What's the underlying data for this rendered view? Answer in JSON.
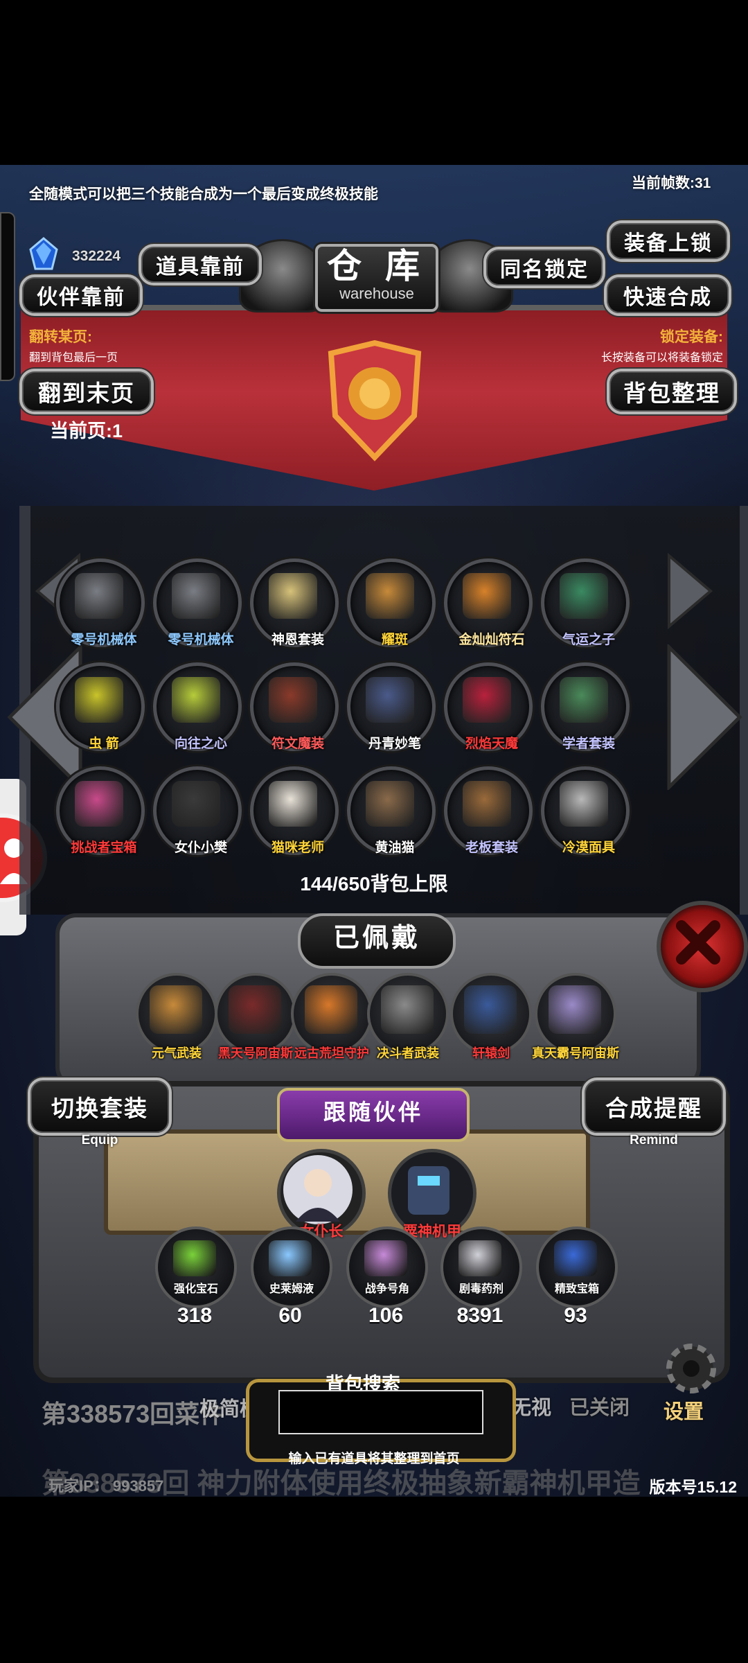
{
  "hud": {
    "hint": "全随模式可以把三个技能合成为一个最后变成终极技能",
    "fps": "当前帧数:31",
    "gem_value": "332224"
  },
  "header": {
    "title": "仓 库",
    "subtitle": "warehouse",
    "buttons": {
      "items_front": "道具靠前",
      "partner_front": "伙伴靠前",
      "same_name_lock": "同名锁定",
      "equip_lock": "装备上锁",
      "quick_merge": "快速合成",
      "to_last_page": "翻到末页",
      "bag_sort": "背包整理"
    },
    "flip_label": "翻转某页:",
    "flip_desc": "翻到背包最后一页",
    "lock_label": "锁定装备:",
    "lock_desc": "长按装备可以将装备锁定",
    "current_page": "当前页:1"
  },
  "inventory": {
    "items": [
      {
        "label": "零号机械体",
        "color": "#8ec9ff",
        "icon": "#7a7d84"
      },
      {
        "label": "零号机械体",
        "color": "#8ec9ff",
        "icon": "#7a7d84"
      },
      {
        "label": "神恩套装",
        "color": "#ffffff",
        "icon": "#d7c27a"
      },
      {
        "label": "耀斑",
        "color": "#ffd53a",
        "icon": "#c78a3a"
      },
      {
        "label": "金灿灿符石",
        "color": "#ffe7a0",
        "icon": "#d8822a"
      },
      {
        "label": "气运之子",
        "color": "#c3c3ff",
        "icon": "#3a8a62"
      },
      {
        "label": "虫 箭",
        "color": "#ffd53a",
        "icon": "#c9c42a"
      },
      {
        "label": "向往之心",
        "color": "#c3c3ff",
        "icon": "#b7cc3a"
      },
      {
        "label": "符文魔装",
        "color": "#ff5a5a",
        "icon": "#8a3a2a"
      },
      {
        "label": "丹青妙笔",
        "color": "#ffffff",
        "icon": "#4a5a8a"
      },
      {
        "label": "烈焰天魔",
        "color": "#ff3a3a",
        "icon": "#b8213c"
      },
      {
        "label": "学者套装",
        "color": "#c3c3ff",
        "icon": "#4a8a5a"
      },
      {
        "label": "挑战者宝箱",
        "color": "#ff3a3a",
        "icon": "#c84a8a"
      },
      {
        "label": "女仆小樊",
        "color": "#ffffff",
        "icon": "#3a3a3a"
      },
      {
        "label": "猫咪老师",
        "color": "#ffd53a",
        "icon": "#e8e2d8"
      },
      {
        "label": "黄油猫",
        "color": "#ffffff",
        "icon": "#8a6a4a"
      },
      {
        "label": "老板套装",
        "color": "#c3c3ff",
        "icon": "#9a6a3a"
      },
      {
        "label": "冷漠面具",
        "color": "#ffd53a",
        "icon": "#b8b8b8"
      }
    ],
    "capacity": "144/650背包上限"
  },
  "equipped": {
    "title": "已佩戴",
    "items": [
      {
        "label": "元气武装",
        "color": "#ffd53a",
        "icon": "#c78a3a"
      },
      {
        "label": "黑天号阿宙斯",
        "color": "#ff3a3a",
        "icon": "#7a2a2a"
      },
      {
        "label": "远古荒坦守护",
        "color": "#ff3a3a",
        "icon": "#d7782a"
      },
      {
        "label": "决斗者武装",
        "color": "#ffd53a",
        "icon": "#8a8a8a"
      },
      {
        "label": "轩辕剑",
        "color": "#ff3a3a",
        "icon": "#3a5a9a"
      },
      {
        "label": "真天霸号阿宙斯",
        "color": "#ffd53a",
        "icon": "#9a8ac8"
      }
    ]
  },
  "controls": {
    "switch_set": "切换套装",
    "switch_set_sub": "Equip",
    "merge_remind": "合成提醒",
    "merge_remind_sub": "Remind"
  },
  "follow": {
    "title": "跟随伙伴",
    "partners": [
      {
        "label": "女仆长",
        "color": "#ff3a3a"
      },
      {
        "label": "粟神机甲",
        "color": "#ff3a3a"
      }
    ]
  },
  "resources": [
    {
      "label": "强化宝石",
      "count": "318",
      "icon": "#7ad23a"
    },
    {
      "label": "史莱姆液",
      "count": "60",
      "icon": "#8ac8ff"
    },
    {
      "label": "战争号角",
      "count": "106",
      "icon": "#c78ad8"
    },
    {
      "label": "剧毒药剂",
      "count": "8391",
      "icon": "#d0d0d8"
    },
    {
      "label": "精致宝箱",
      "count": "93",
      "icon": "#3a6ad8"
    }
  ],
  "search": {
    "title": "背包搜索",
    "value": "",
    "hint": "输入已有道具将其整理到首页"
  },
  "background": {
    "round_text": "第338573回菜件",
    "scroll_text": "第338573回 神力附体使用终极抽象新霸神机甲造",
    "ip": "玩家IP： 993857",
    "version": "版本号15.12",
    "simplified": "极简模",
    "no_view": "无视",
    "closed": "已关闭",
    "settings": "设置"
  }
}
